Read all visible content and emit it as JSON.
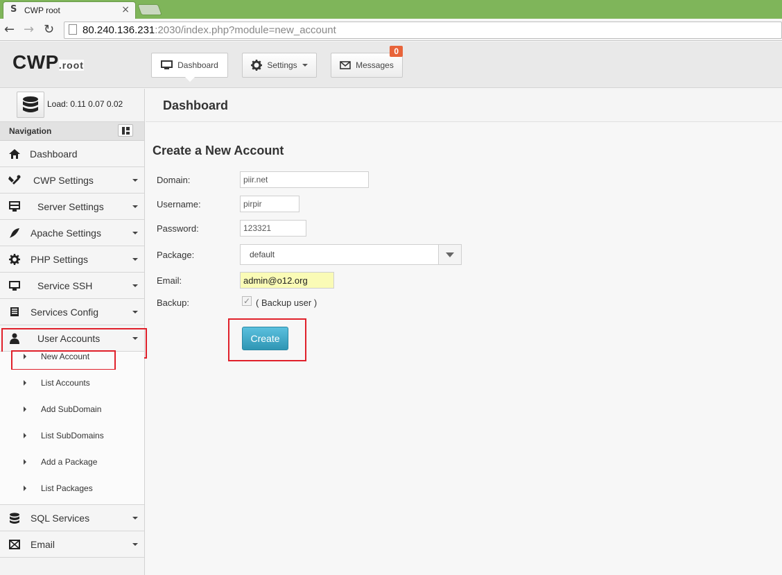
{
  "browser": {
    "tab_favicon": "S",
    "tab_title": "CWP root",
    "tab_close": "×",
    "url_host": "80.240.136.231",
    "url_rest": ":2030/index.php?module=new_account"
  },
  "header": {
    "logo_main": "CWP",
    "logo_sub": ".root",
    "buttons": {
      "dashboard": "Dashboard",
      "settings": "Settings",
      "messages": "Messages",
      "messages_count": "0"
    }
  },
  "sidebar": {
    "load_text": "Load: 0.11  0.07  0.02",
    "nav_title": "Navigation",
    "items": [
      {
        "label": "Dashboard",
        "icon": "home-icon"
      },
      {
        "label": "CWP Settings",
        "icon": "tools-icon"
      },
      {
        "label": "Server Settings",
        "icon": "server-icon"
      },
      {
        "label": "Apache Settings",
        "icon": "feather-icon"
      },
      {
        "label": "PHP Settings",
        "icon": "gear-icon"
      },
      {
        "label": "Service SSH",
        "icon": "monitor-icon"
      },
      {
        "label": "Services Config",
        "icon": "book-icon"
      },
      {
        "label": "User Accounts",
        "icon": "user-icon"
      }
    ],
    "subitems": [
      "New Account",
      "List Accounts",
      "Add SubDomain",
      "List SubDomains",
      "Add a Package",
      "List Packages"
    ],
    "items_after": [
      {
        "label": "SQL Services",
        "icon": "database-icon"
      },
      {
        "label": "Email",
        "icon": "envelope-icon"
      }
    ]
  },
  "page": {
    "title": "Dashboard",
    "form_title": "Create a New Account",
    "labels": {
      "domain": "Domain:",
      "username": "Username:",
      "password": "Password:",
      "package": "Package:",
      "email": "Email:",
      "backup": "Backup:"
    },
    "values": {
      "domain": "piir.net",
      "username": "pirpir",
      "password": "123321",
      "package": "default",
      "email": "admin@o12.org",
      "backup_checked": true
    },
    "backup_text": "( Backup user )",
    "create_label": "Create"
  },
  "colors": {
    "tabbar": "#7fb55a",
    "highlight_box": "#e0202a",
    "create_button": "#5bc0de",
    "badge": "#e8643a",
    "email_autofill": "#fafbb6"
  }
}
